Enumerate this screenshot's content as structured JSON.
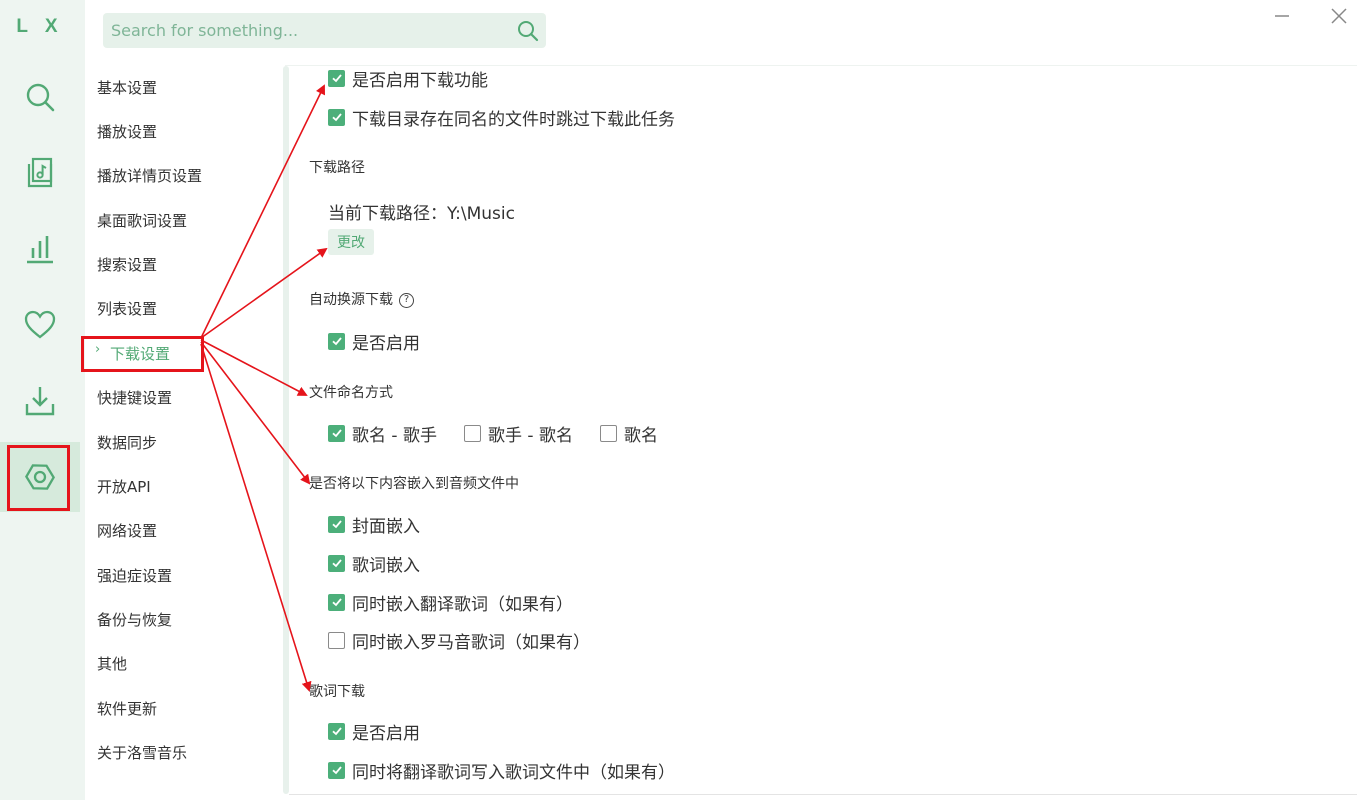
{
  "app": {
    "logo": "L X"
  },
  "colors": {
    "accent": "#52a975",
    "rail_bg": "#eef5f1",
    "annotation_red": "#e5141b"
  },
  "rail": [
    {
      "name": "search-icon"
    },
    {
      "name": "music-list-icon"
    },
    {
      "name": "leaderboard-icon"
    },
    {
      "name": "heart-icon"
    },
    {
      "name": "download-icon"
    },
    {
      "name": "settings-icon",
      "active": true
    }
  ],
  "search": {
    "placeholder": "Search for something..."
  },
  "window": {
    "minimize": "minimize-icon",
    "close": "close-icon"
  },
  "subnav": {
    "items": [
      {
        "label": "基本设置"
      },
      {
        "label": "播放设置"
      },
      {
        "label": "播放详情页设置"
      },
      {
        "label": "桌面歌词设置"
      },
      {
        "label": "搜索设置"
      },
      {
        "label": "列表设置"
      },
      {
        "label": "下载设置",
        "active": true
      },
      {
        "label": "快捷键设置"
      },
      {
        "label": "数据同步"
      },
      {
        "label": "开放API"
      },
      {
        "label": "网络设置"
      },
      {
        "label": "强迫症设置"
      },
      {
        "label": "备份与恢复"
      },
      {
        "label": "其他"
      },
      {
        "label": "软件更新"
      },
      {
        "label": "关于洛雪音乐"
      }
    ]
  },
  "download": {
    "enable": {
      "label": "是否启用下载功能",
      "checked": true
    },
    "skip_existing": {
      "label": "下载目录存在同名的文件时跳过下载此任务",
      "checked": true
    },
    "path": {
      "title": "下载路径",
      "current_label": "当前下载路径：",
      "current_value": "Y:\\Music",
      "change_button": "更改"
    },
    "auto_switch": {
      "title": "自动换源下载",
      "enable": {
        "label": "是否启用",
        "checked": true
      }
    },
    "naming": {
      "title": "文件命名方式",
      "options": [
        {
          "label": "歌名 - 歌手",
          "checked": true
        },
        {
          "label": "歌手 - 歌名",
          "checked": false
        },
        {
          "label": "歌名",
          "checked": false
        }
      ]
    },
    "embed": {
      "title": "是否将以下内容嵌入到音频文件中",
      "options": [
        {
          "label": "封面嵌入",
          "checked": true
        },
        {
          "label": "歌词嵌入",
          "checked": true
        },
        {
          "label": "同时嵌入翻译歌词（如果有）",
          "checked": true
        },
        {
          "label": "同时嵌入罗马音歌词（如果有）",
          "checked": false
        }
      ]
    },
    "lyrics": {
      "title": "歌词下载",
      "enable": {
        "label": "是否启用",
        "checked": true
      },
      "translated": {
        "label": "同时将翻译歌词写入歌词文件中（如果有）",
        "checked": true
      }
    }
  }
}
